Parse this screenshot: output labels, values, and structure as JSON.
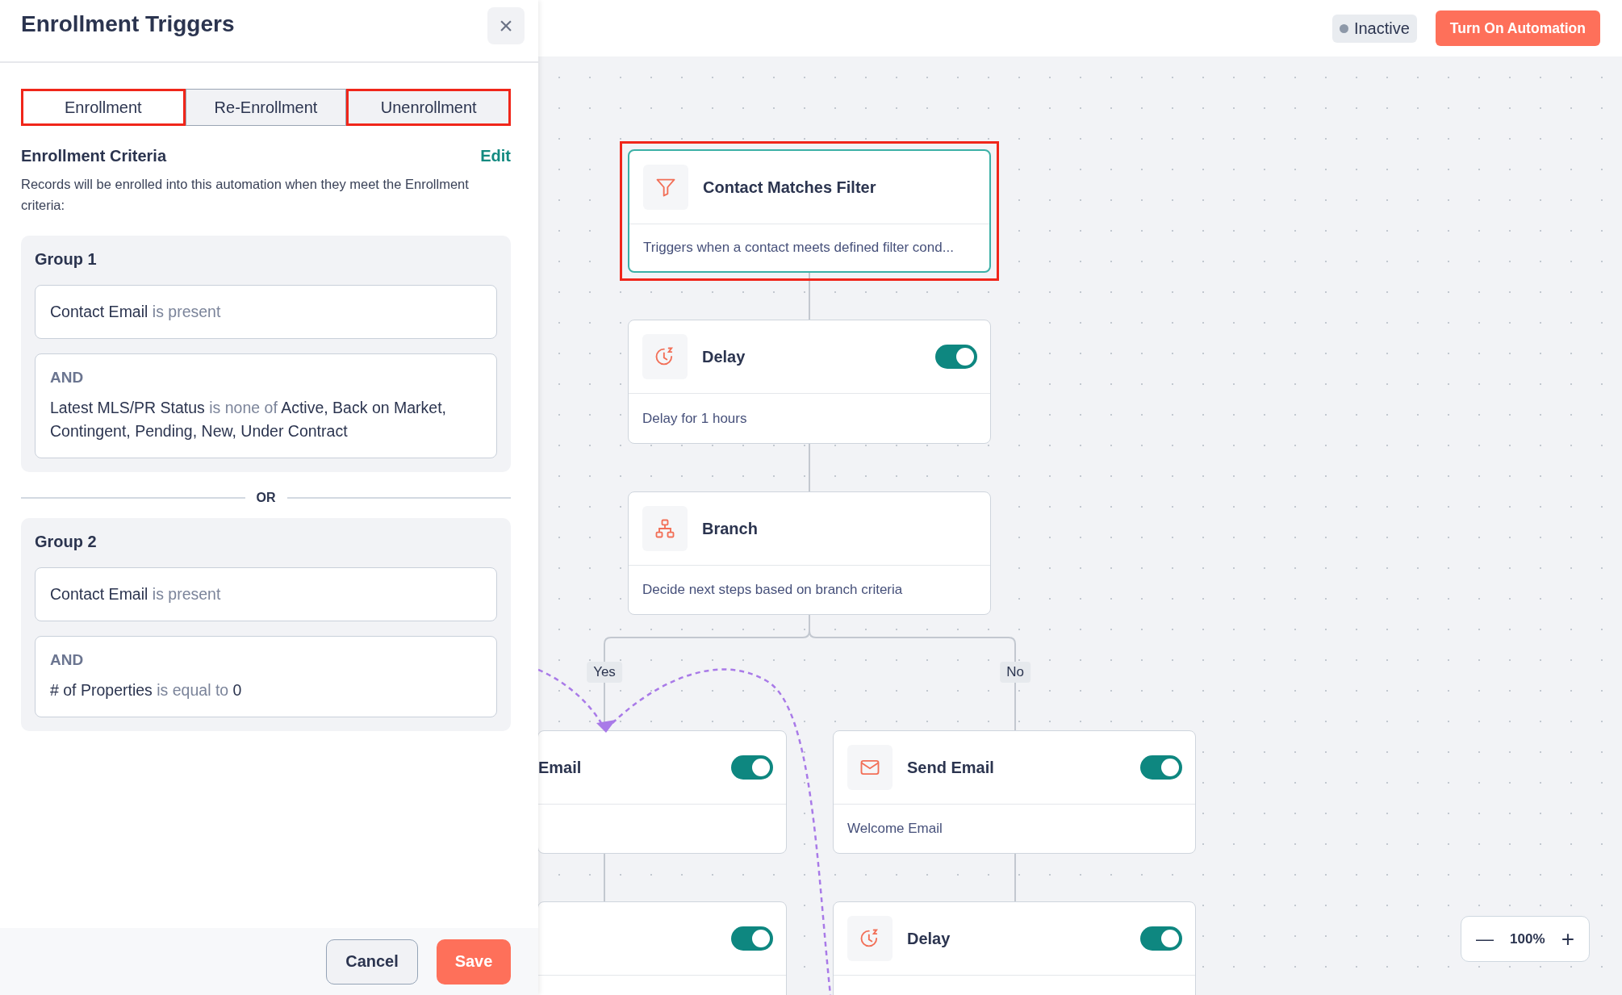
{
  "panel": {
    "title": "Enrollment Triggers",
    "close": "×",
    "tabs": [
      {
        "label": "Enrollment",
        "selected": true,
        "highlighted": true
      },
      {
        "label": "Re-Enrollment",
        "selected": false,
        "highlighted": false
      },
      {
        "label": "Unenrollment",
        "selected": false,
        "highlighted": true
      }
    ],
    "criteria_title": "Enrollment Criteria",
    "edit": "Edit",
    "description": "Records will be enrolled into this automation when they meet the Enrollment criteria:",
    "groups": [
      {
        "title": "Group 1",
        "conditions": [
          {
            "text": "**Contact Email** is present"
          },
          {
            "prefix": "AND",
            "text": "**Latest MLS/PR Status** is none of **Active, Back on Market, Contingent, Pending, New, Under Contract**"
          }
        ]
      },
      {
        "title": "Group 2",
        "conditions": [
          {
            "text": "**Contact Email** is present"
          },
          {
            "prefix": "AND",
            "text": "**# of Properties** is equal to **0**"
          }
        ]
      }
    ],
    "separator": "OR",
    "cancel": "Cancel",
    "save": "Save"
  },
  "top_bar": {
    "status": "Inactive",
    "action": "Turn On Automation"
  },
  "nodes": [
    {
      "kind": "filter",
      "title": "Contact Matches Filter",
      "description": "Triggers when a contact meets defined filter cond...",
      "selected": true,
      "highlighted": true
    },
    {
      "kind": "delay",
      "title": "Delay",
      "description": "Delay for 1 hours",
      "toggle_on": true,
      "selected": false,
      "highlighted": false
    },
    {
      "kind": "branch",
      "title": "Branch",
      "description": "Decide next steps based on branch criteria",
      "selected": false,
      "highlighted": false
    },
    {
      "kind": "clipped",
      "title": "Email",
      "toggle_on": true,
      "selected": false,
      "highlighted": false
    },
    {
      "kind": "email",
      "title": "Send Email",
      "description": "Welcome Email",
      "toggle_on": true,
      "selected": false,
      "highlighted": false
    },
    {
      "kind": "clipped",
      "toggle_on": true,
      "selected": false,
      "highlighted": false
    },
    {
      "kind": "delay",
      "title": "Delay",
      "toggle_on": true,
      "selected": false,
      "highlighted": false
    }
  ],
  "branch_labels": [
    "Yes",
    "No"
  ],
  "zoom": {
    "minus": "—",
    "level": "100%",
    "plus": "+"
  }
}
